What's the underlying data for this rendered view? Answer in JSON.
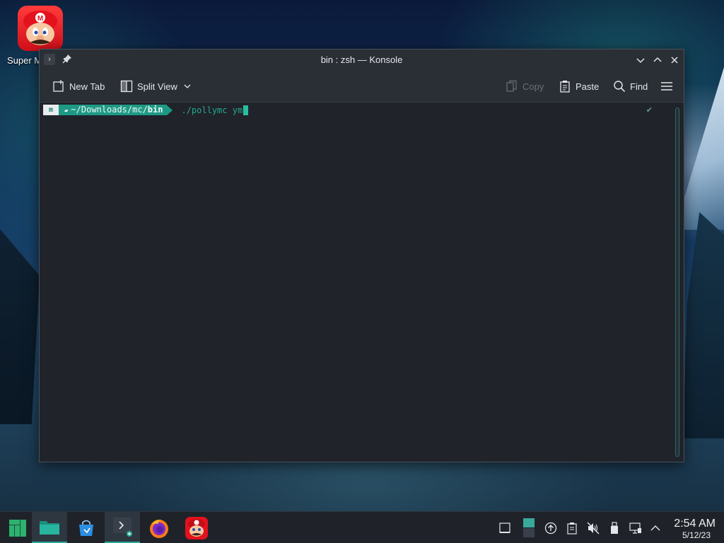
{
  "desktop": {
    "icons": [
      {
        "label": "Super M",
        "icon": "mario-icon"
      }
    ]
  },
  "window": {
    "title": "bin : zsh — Konsole",
    "app_icon": "terminal-icon",
    "pin_icon": "pin-icon",
    "controls": [
      "chevron-down-icon",
      "chevron-up-icon",
      "close-icon"
    ]
  },
  "toolbar": {
    "new_tab": "New Tab",
    "split_view": "Split View",
    "copy": "Copy",
    "paste": "Paste",
    "find": "Find"
  },
  "terminal": {
    "prompt_os_glyph": "m",
    "prompt_path_prefix": "~/Downloads/mc/",
    "prompt_path_bold": "bin",
    "command": "./pollymc ym",
    "status_mark": "✔"
  },
  "taskbar": {
    "items": [
      {
        "name": "application-launcher",
        "icon": "manjaro-icon"
      },
      {
        "name": "dolphin",
        "icon": "folder-icon",
        "active": true
      },
      {
        "name": "discover",
        "icon": "store-icon"
      },
      {
        "name": "konsole",
        "icon": "terminal-icon",
        "active": true
      },
      {
        "name": "firefox",
        "icon": "firefox-icon"
      },
      {
        "name": "super-mario",
        "icon": "mario-icon"
      }
    ],
    "tray": [
      "show-desktop-icon",
      "pager-icon",
      "updates-icon",
      "clipboard-icon",
      "volume-muted-icon",
      "usb-icon",
      "network-icon",
      "expand-tray-icon"
    ],
    "clock_time": "2:54 AM",
    "clock_date": "5/12/23"
  },
  "colors": {
    "accent": "#1d9a85",
    "terminal_bg": "#20232a",
    "window_chrome": "#2a2e35",
    "panel": "#1f2329"
  }
}
